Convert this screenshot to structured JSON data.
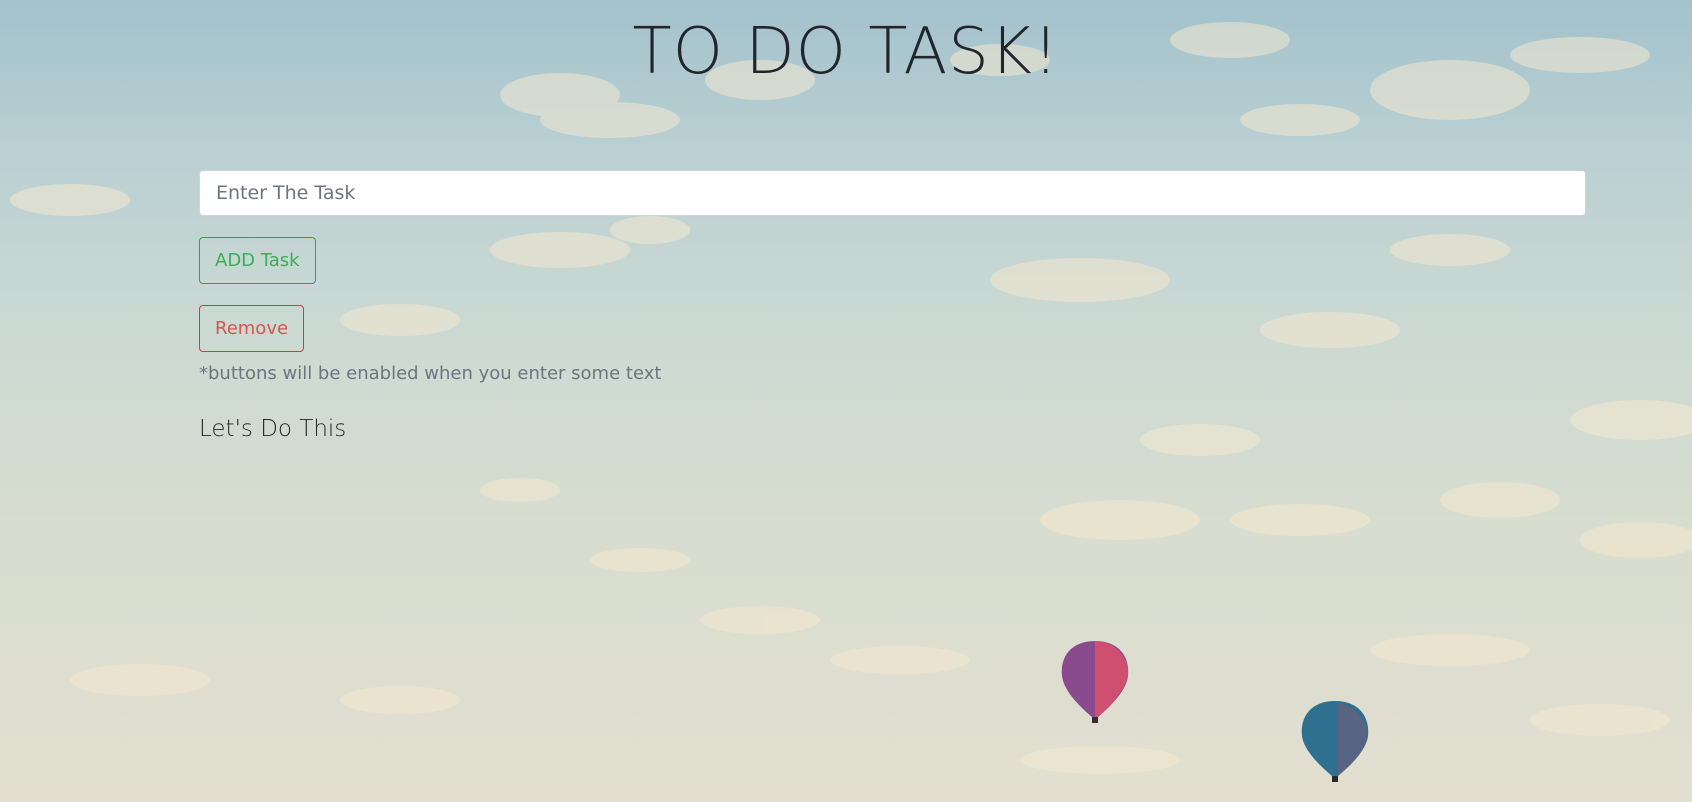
{
  "header": {
    "title": "TO DO TASK!"
  },
  "form": {
    "task_placeholder": "Enter The Task",
    "task_value": "",
    "add_label": "ADD Task",
    "remove_label": "Remove",
    "hint": "*buttons will be enabled when you enter some text"
  },
  "list": {
    "title": "Let's Do This"
  },
  "colors": {
    "add_button": "#28a745",
    "remove_button": "#dc3545",
    "sky_top": "#a3c2cc",
    "sky_bottom": "#e2dfd0"
  },
  "background": {
    "scene": "sky-with-hot-air-balloons"
  }
}
